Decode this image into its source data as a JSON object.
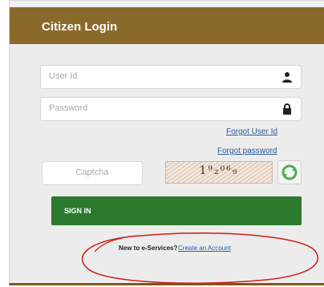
{
  "header": {
    "title": "Citizen Login"
  },
  "form": {
    "user_id_placeholder": "User Id",
    "password_placeholder": "Password",
    "forgot_user_id": "Forgot User Id",
    "forgot_password": "Forgot password",
    "captcha_placeholder": "Captcha",
    "captcha_image_text": "1⁹₂⁰⁶₉",
    "sign_in_label": "SIGN IN"
  },
  "footer": {
    "new_text": "New to e-Services?",
    "create_account_label": "Create an Account"
  },
  "colors": {
    "header_bg": "#8a6a2b",
    "sign_in_bg": "#2b7a2e",
    "link": "#2c5aa0",
    "annotation": "#d11b1b"
  }
}
